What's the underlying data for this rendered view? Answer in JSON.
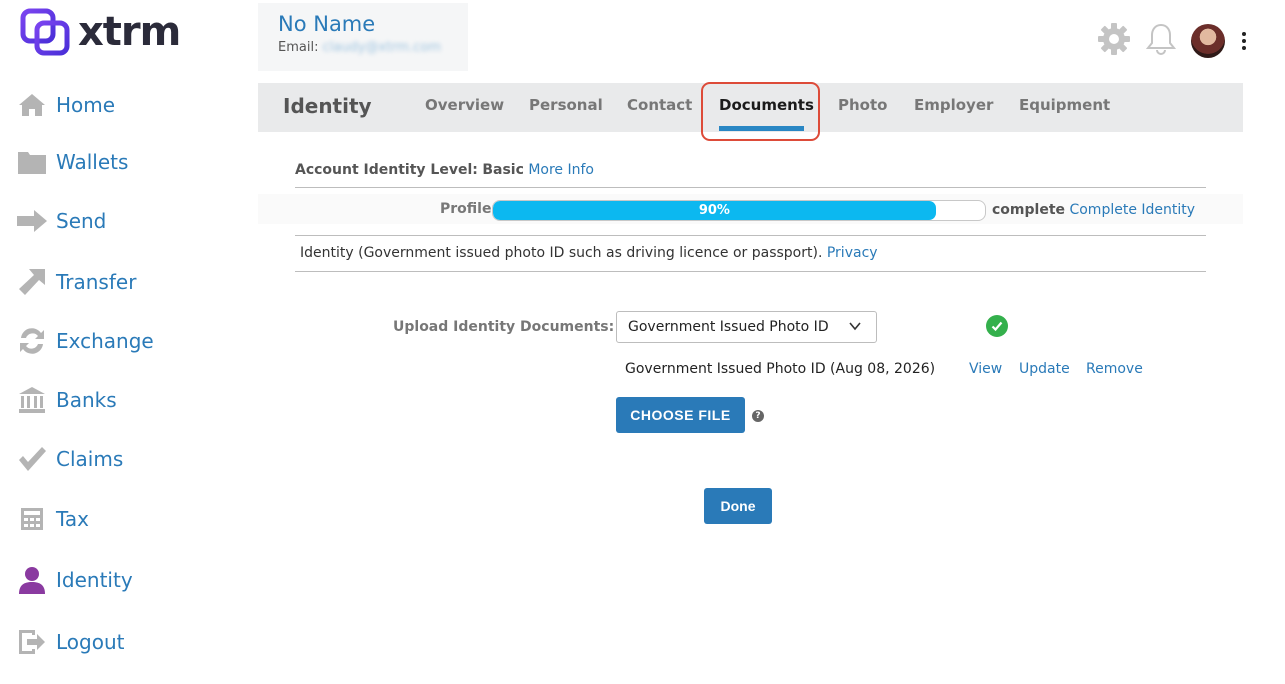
{
  "app": {
    "logo_text": "xtrm",
    "brand_color": "#6a3ce8",
    "link_color": "#2a7ab8"
  },
  "user": {
    "name": "No Name",
    "email_label": "Email:",
    "email_value": "claudy@xtrm.com"
  },
  "sidebar": {
    "items": [
      {
        "label": "Home",
        "icon": "home-icon"
      },
      {
        "label": "Wallets",
        "icon": "folder-icon"
      },
      {
        "label": "Send",
        "icon": "arrow-right-icon"
      },
      {
        "label": "Transfer",
        "icon": "arrow-up-right-icon"
      },
      {
        "label": "Exchange",
        "icon": "exchange-icon"
      },
      {
        "label": "Banks",
        "icon": "bank-icon"
      },
      {
        "label": "Claims",
        "icon": "check-icon"
      },
      {
        "label": "Tax",
        "icon": "calculator-icon"
      },
      {
        "label": "Identity",
        "icon": "user-icon"
      },
      {
        "label": "Logout",
        "icon": "logout-icon"
      }
    ]
  },
  "header_icons": [
    "gear-icon",
    "bell-icon",
    "avatar",
    "kebab-menu-icon"
  ],
  "tabs": {
    "title": "Identity",
    "items": [
      {
        "label": "Overview"
      },
      {
        "label": "Personal"
      },
      {
        "label": "Contact"
      },
      {
        "label": "Documents",
        "active": true
      },
      {
        "label": "Photo"
      },
      {
        "label": "Employer"
      },
      {
        "label": "Equipment"
      }
    ]
  },
  "identity": {
    "level_label": "Account Identity Level:",
    "level_value": "Basic",
    "more_info": "More Info",
    "profile_label": "Profile",
    "progress_percent": 90,
    "progress_text": "90%",
    "complete_text": "complete",
    "complete_link": "Complete Identity",
    "id_description": "Identity (Government issued photo ID such as driving licence or passport).",
    "privacy_link": "Privacy"
  },
  "upload": {
    "label": "Upload Identity Documents:",
    "selected_option": "Government Issued Photo ID",
    "document_name": "Government Issued Photo ID (Aug 08, 2026)",
    "view": "View",
    "update": "Update",
    "remove": "Remove",
    "choose_file": "CHOOSE FILE",
    "help_glyph": "?",
    "done": "Done"
  }
}
